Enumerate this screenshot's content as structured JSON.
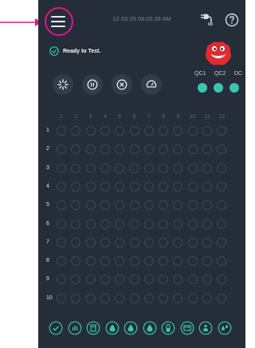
{
  "header": {
    "menu_icon": "hamburger-menu-icon",
    "timestamp": "12-23-25 06:05:28 AM",
    "plug_icon": "plug-icon",
    "help_icon": "help-icon"
  },
  "status": {
    "icon": "check-circle-icon",
    "text": "Ready to Test."
  },
  "mascot": {
    "icon": "red-mascot-icon"
  },
  "qc": {
    "labels": [
      "QC1",
      "QC2",
      "DC"
    ],
    "color": "#39c6b1"
  },
  "controls": [
    {
      "name": "start-control-button",
      "icon": "sparkle-icon"
    },
    {
      "name": "pause-control-button",
      "icon": "pause-icon"
    },
    {
      "name": "cancel-control-button",
      "icon": "cancel-icon"
    },
    {
      "name": "gauge-control-button",
      "icon": "gauge-icon"
    }
  ],
  "plate": {
    "columns": [
      "1",
      "2",
      "3",
      "4",
      "5",
      "6",
      "7",
      "8",
      "9",
      "10",
      "11",
      "12"
    ],
    "rows": [
      "1",
      "2",
      "3",
      "4",
      "5",
      "6",
      "7",
      "8",
      "9",
      "10"
    ]
  },
  "bottom_bar": {
    "icons": [
      "check-icon",
      "bars-icon",
      "cartridge-icon",
      "drop-icon",
      "drop-icon",
      "drop-icon",
      "pill-icon",
      "card-icon",
      "person-drop-icon",
      "drops-icon"
    ]
  },
  "colors": {
    "accent_annotation": "#e4148a",
    "background": "#252d39",
    "teal": "#39c6b1"
  }
}
